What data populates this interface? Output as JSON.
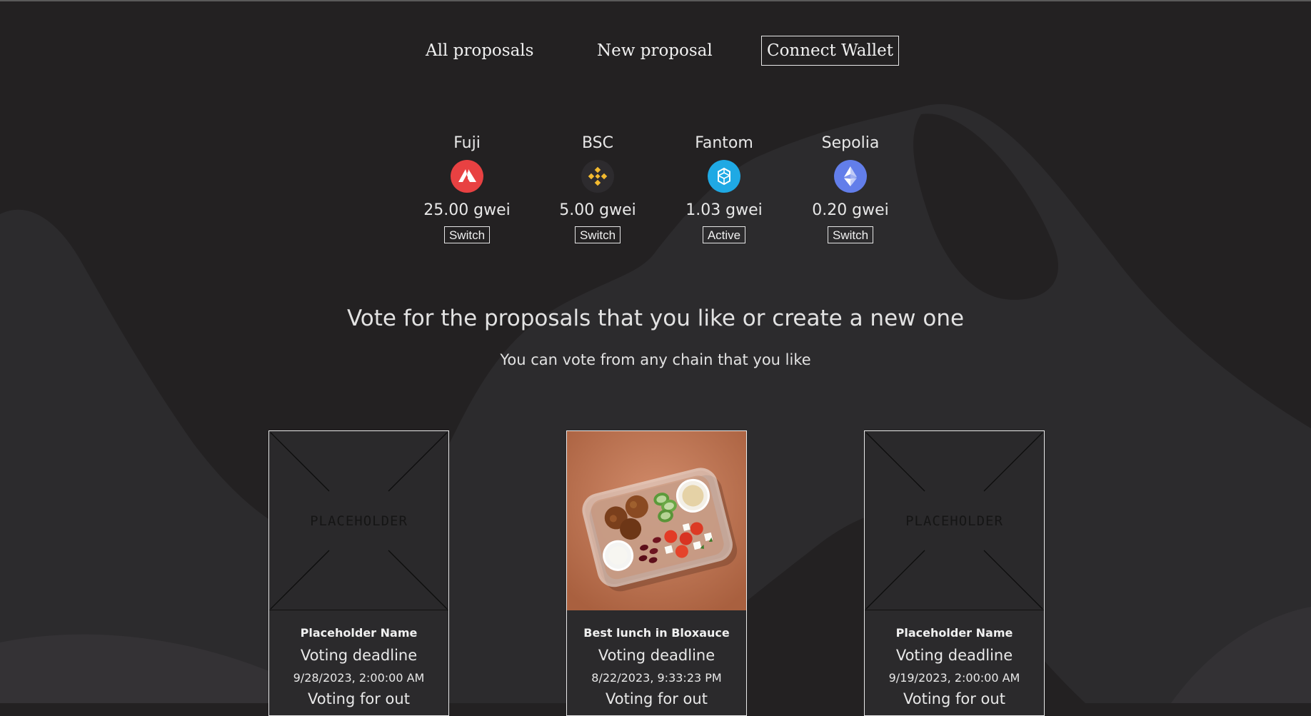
{
  "nav": {
    "all_proposals": "All proposals",
    "new_proposal": "New proposal",
    "connect_wallet": "Connect Wallet"
  },
  "chains": [
    {
      "name": "Fuji",
      "gas": "25.00 gwei",
      "button": "Switch",
      "icon": "avalanche-icon",
      "color": "#e84142"
    },
    {
      "name": "BSC",
      "gas": "5.00 gwei",
      "button": "Switch",
      "icon": "bnb-icon",
      "color": "#f3ba2f"
    },
    {
      "name": "Fantom",
      "gas": "1.03 gwei",
      "button": "Active",
      "icon": "fantom-icon",
      "color": "#1fa9e4"
    },
    {
      "name": "Sepolia",
      "gas": "0.20 gwei",
      "button": "Switch",
      "icon": "ethereum-icon",
      "color": "#627eea"
    }
  ],
  "hero": {
    "title": "Vote for the proposals that you like or create a new one",
    "subtitle": "You can vote from any chain that you like"
  },
  "proposals": [
    {
      "name": "Placeholder Name",
      "deadline_label": "Voting deadline",
      "deadline": "9/28/2023, 2:00:00 AM",
      "image": "PLACEHOLDER",
      "extra": "Voting for out"
    },
    {
      "name": "Best lunch in Bloxauce",
      "deadline_label": "Voting deadline",
      "deadline": "8/22/2023, 9:33:23 PM",
      "image": "meal-prep-photo",
      "extra": "Voting for out"
    },
    {
      "name": "Placeholder Name",
      "deadline_label": "Voting deadline",
      "deadline": "9/19/2023, 2:00:00 AM",
      "image": "PLACEHOLDER",
      "extra": "Voting for out"
    }
  ]
}
